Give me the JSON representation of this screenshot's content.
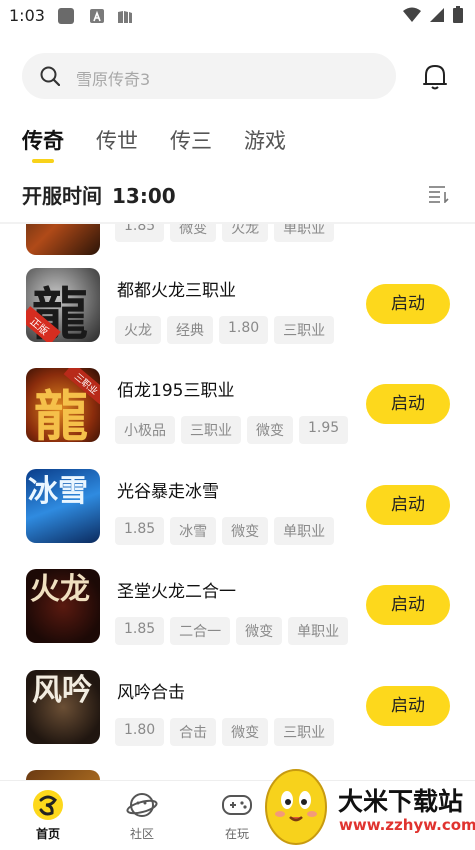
{
  "status": {
    "time": "1:03"
  },
  "search": {
    "placeholder": "雪原传奇3"
  },
  "tabs": [
    {
      "label": "传奇",
      "active": true
    },
    {
      "label": "传世",
      "active": false
    },
    {
      "label": "传三",
      "active": false
    },
    {
      "label": "游戏",
      "active": false
    }
  ],
  "open_server": {
    "label": "开服时间",
    "time": "13:00"
  },
  "partial_top_tags": [
    "1.85",
    "微变",
    "火龙",
    "单职业"
  ],
  "games": [
    {
      "title": "都都火龙三职业",
      "tags": [
        "火龙",
        "经典",
        "1.80",
        "三职业"
      ],
      "button": "启动",
      "thumb_text": "龍",
      "thumb_badge": "正版"
    },
    {
      "title": "佰龙195三职业",
      "tags": [
        "小极品",
        "三职业",
        "微变",
        "1.95"
      ],
      "button": "启动",
      "thumb_text": "龍",
      "thumb_badge": "三职业"
    },
    {
      "title": "光谷暴走冰雪",
      "tags": [
        "1.85",
        "冰雪",
        "微变",
        "单职业"
      ],
      "button": "启动",
      "thumb_text": "冰雪",
      "thumb_badge": ""
    },
    {
      "title": "圣堂火龙二合一",
      "tags": [
        "1.85",
        "二合一",
        "微变",
        "单职业"
      ],
      "button": "启动",
      "thumb_text": "火龙",
      "thumb_badge": ""
    },
    {
      "title": "风吟合击",
      "tags": [
        "1.80",
        "合击",
        "微变",
        "三职业"
      ],
      "button": "启动",
      "thumb_text": "风吟",
      "thumb_badge": ""
    }
  ],
  "bottom_nav": [
    {
      "label": "首页",
      "icon": "home-logo-icon",
      "active": true
    },
    {
      "label": "社区",
      "icon": "planet-icon",
      "active": false
    },
    {
      "label": "在玩",
      "icon": "gamepad-icon",
      "active": false
    }
  ],
  "watermark": {
    "name": "大米下载站",
    "url": "www.zzhyw.com"
  },
  "colors": {
    "accent": "#fdd81c",
    "tag_bg": "#f2f2f2",
    "tag_text": "#8a8a8a"
  }
}
